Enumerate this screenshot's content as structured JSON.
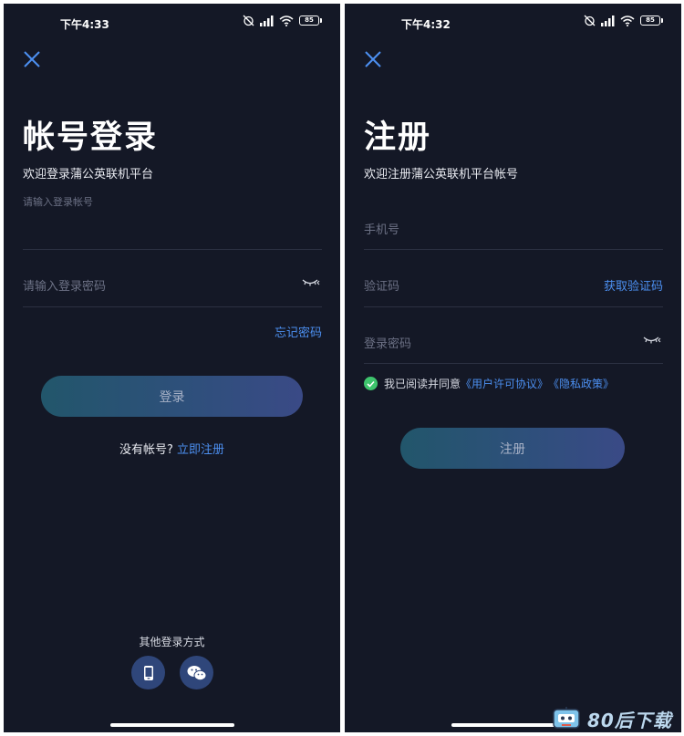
{
  "login": {
    "status_time": "下午4:33",
    "battery": "85",
    "title": "帐号登录",
    "subtitle": "欢迎登录蒲公英联机平台",
    "account_placeholder": "请输入登录帐号",
    "password_placeholder": "请输入登录密码",
    "forgot_password": "忘记密码",
    "login_button": "登录",
    "no_account": "没有帐号?",
    "register_now": "立即注册",
    "other_methods": "其他登录方式",
    "icons": [
      "close-icon",
      "eye-closed-icon",
      "phone-icon",
      "wechat-icon"
    ]
  },
  "register": {
    "status_time": "下午4:32",
    "battery": "85",
    "title": "注册",
    "subtitle": "欢迎注册蒲公英联机平台帐号",
    "phone_placeholder": "手机号",
    "code_placeholder": "验证码",
    "get_code": "获取验证码",
    "password_placeholder": "登录密码",
    "agree_prefix": "我已阅读并同意",
    "user_agreement": "《用户许可协议》",
    "privacy_policy": "《隐私政策》",
    "register_button": "注册",
    "icons": [
      "close-icon",
      "eye-closed-icon",
      "checkmark-icon"
    ]
  },
  "watermark": {
    "text": "80后下载",
    "icons": [
      "robot-logo-icon"
    ]
  },
  "colors": {
    "background": "#141826",
    "accent_blue": "#4c8ff0",
    "check_green": "#3ec46d",
    "button_gradient_start": "#22566b",
    "button_gradient_end": "#3a4a86",
    "social_button": "#2f467a"
  }
}
